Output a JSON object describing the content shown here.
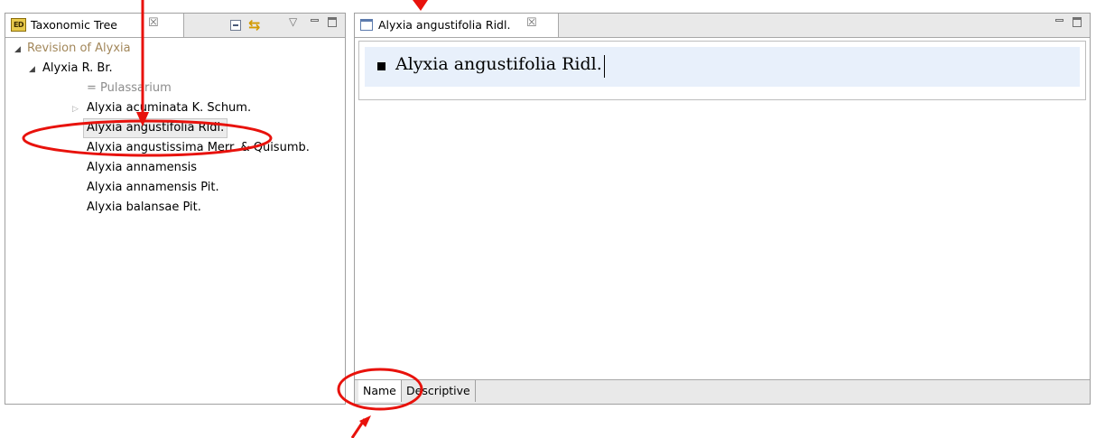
{
  "left_view": {
    "tab_title": "Taxonomic Tree",
    "tab_close_glyph": "☒",
    "icons": [
      "ed-app-icon",
      "collapse-all-icon",
      "link-with-editor-icon",
      "view-menu-icon",
      "minimize-icon",
      "maximize-icon"
    ]
  },
  "tree": {
    "root": "Revision of Alyxia",
    "genus": "Alyxia R. Br.",
    "synonym": "= Pulassarium",
    "items": [
      "Alyxia acuminata K. Schum.",
      "Alyxia angustifolia Ridl.",
      "Alyxia angustissima Merr. & Quisumb.",
      "Alyxia annamensis",
      "Alyxia annamensis Pit.",
      "Alyxia balansae Pit."
    ],
    "selected_index": 1
  },
  "editor": {
    "tab_title": "Alyxia angustifolia Ridl.",
    "tab_close_glyph": "☒",
    "name_text": "Alyxia angustifolia Ridl.",
    "bottom_tabs": [
      "Name",
      "Descriptive"
    ],
    "active_bottom_tab": "Name"
  },
  "colors": {
    "annotation": "#e8120c",
    "root_node": "#a2875a",
    "synonym": "#8c8c8c",
    "name_field_bg": "#e8f0fb"
  }
}
